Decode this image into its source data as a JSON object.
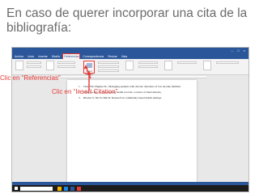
{
  "slide": {
    "title": "En caso de querer incorporar una cita de la bibliografía:"
  },
  "callouts": {
    "references": "Clic en “Referencias”",
    "insert_citation": "Clic en “Insert Citation”"
  },
  "word": {
    "ribbon_tabs": [
      {
        "label": "Archivo",
        "active": false
      },
      {
        "label": "Inicio",
        "active": false
      },
      {
        "label": "Insertar",
        "active": false
      },
      {
        "label": "Diseño",
        "active": false
      },
      {
        "label": "Referencias",
        "active": true
      },
      {
        "label": "Correspondencia",
        "active": false
      },
      {
        "label": "Revisar",
        "active": false
      },
      {
        "label": "Vista",
        "active": false
      }
    ],
    "ribbon": {
      "insert_citation_label": "Insert Citation"
    },
    "references": [
      {
        "num": "1.",
        "text": "Chen YR, Hughes SL. Managing patients with chronic disorders of low income families:",
        "link": ""
      },
      {
        "num": "2.",
        "text": "Glasgow RE, et al. Accessing health records: a review of interventions.",
        "link": ""
      },
      {
        "num": "3.",
        "text": "Rhodes S, Shi W, Bell R. Research in community based health settings.",
        "link": ""
      }
    ]
  },
  "colors": {
    "accent_red": "#e53935",
    "word_blue": "#2b579a",
    "title_gray": "#6b6b6b"
  }
}
